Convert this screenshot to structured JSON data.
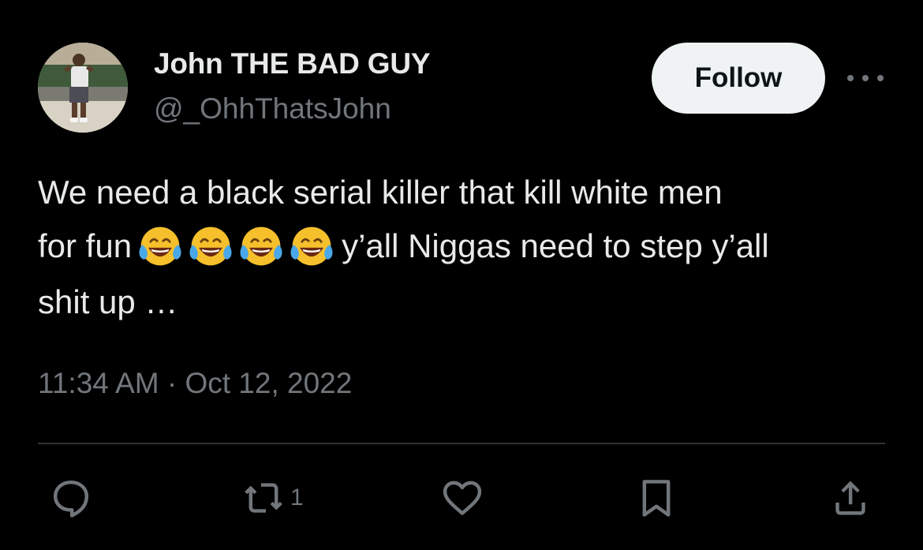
{
  "user": {
    "display_name": "John THE BAD GUY",
    "handle": "@_OhhThatsJohn",
    "avatar_icon": "profile-photo"
  },
  "follow_button": {
    "label": "Follow"
  },
  "more_menu": {
    "icon": "more-horizontal-icon"
  },
  "tweet": {
    "text_line_1": "We need a black serial killer that kill white men",
    "text_before_emoji": "for fun",
    "emoji_name": "face-with-tears-of-joy",
    "emoji_count": 4,
    "text_after_emoji": "y’all Niggas need to step y’all",
    "text_line_3": "shit up …",
    "timestamp": "11:34 AM · Oct 12, 2022"
  },
  "actions": {
    "reply": {
      "icon": "reply-icon"
    },
    "retweet": {
      "icon": "retweet-icon",
      "count": "1"
    },
    "like": {
      "icon": "heart-icon"
    },
    "bookmark": {
      "icon": "bookmark-icon"
    },
    "share": {
      "icon": "share-icon"
    }
  },
  "colors": {
    "background": "#000000",
    "primary_text": "#e7e9ea",
    "secondary_text": "#71767b",
    "divider": "#2f3336",
    "follow_bg": "#eff3f4",
    "follow_text": "#0f1419"
  }
}
